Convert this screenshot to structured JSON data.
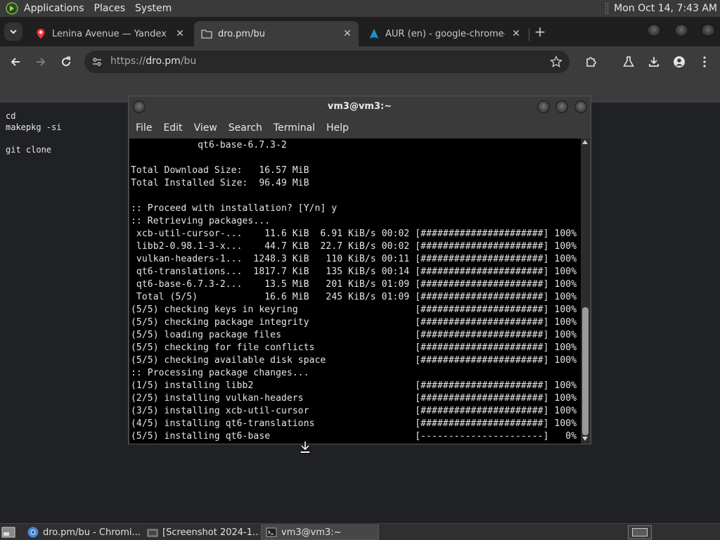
{
  "top_panel": {
    "menus": [
      "Applications",
      "Places",
      "System"
    ],
    "clock": "Mon Oct 14,  7:43 AM"
  },
  "browser": {
    "tabs": [
      {
        "title": "Lenina Avenue — Yandex Ma",
        "favicon": "yandex-maps-icon",
        "active": false
      },
      {
        "title": "dro.pm/bu",
        "favicon": "page-icon",
        "active": true
      },
      {
        "title": "AUR (en) - google-chrome-d",
        "favicon": "arch-linux-icon",
        "active": false
      }
    ],
    "url": {
      "scheme": "https://",
      "host": "dro.pm",
      "path": "/bu"
    }
  },
  "page": {
    "code_lines": [
      "cd",
      "makepkg -si",
      "",
      "git clone"
    ]
  },
  "terminal": {
    "title": "vm3@vm3:~",
    "menus": [
      "File",
      "Edit",
      "View",
      "Search",
      "Terminal",
      "Help"
    ],
    "lines": [
      "            qt6-base-6.7.3-2",
      "",
      "Total Download Size:   16.57 MiB",
      "Total Installed Size:  96.49 MiB",
      "",
      ":: Proceed with installation? [Y/n] y",
      ":: Retrieving packages...",
      " xcb-util-cursor-...    11.6 KiB  6.91 KiB/s 00:02 [######################] 100%",
      " libb2-0.98.1-3-x...    44.7 KiB  22.7 KiB/s 00:02 [######################] 100%",
      " vulkan-headers-1...  1248.3 KiB   110 KiB/s 00:11 [######################] 100%",
      " qt6-translations...  1817.7 KiB   135 KiB/s 00:14 [######################] 100%",
      " qt6-base-6.7.3-2...    13.5 MiB   201 KiB/s 01:09 [######################] 100%",
      " Total (5/5)            16.6 MiB   245 KiB/s 01:09 [######################] 100%",
      "(5/5) checking keys in keyring                     [######################] 100%",
      "(5/5) checking package integrity                   [######################] 100%",
      "(5/5) loading package files                        [######################] 100%",
      "(5/5) checking for file conflicts                  [######################] 100%",
      "(5/5) checking available disk space                [######################] 100%",
      ":: Processing package changes...",
      "(1/5) installing libb2                             [######################] 100%",
      "(2/5) installing vulkan-headers                    [######################] 100%",
      "(3/5) installing xcb-util-cursor                   [######################] 100%",
      "(4/5) installing qt6-translations                  [######################] 100%",
      "(5/5) installing qt6-base                          [----------------------]   0%"
    ]
  },
  "taskbar": {
    "tasks": [
      {
        "label": "dro.pm/bu - Chromi...",
        "icon": "chromium-icon",
        "active": false
      },
      {
        "label": "[Screenshot 2024-1...",
        "icon": "screenshot-icon",
        "active": false
      },
      {
        "label": "vm3@vm3:~",
        "icon": "terminal-icon",
        "active": true
      }
    ]
  }
}
